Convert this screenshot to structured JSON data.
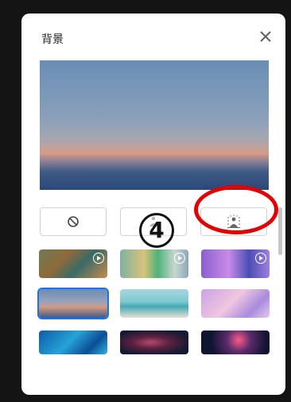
{
  "dialog": {
    "title": "背景",
    "close_icon": "close-icon"
  },
  "options": [
    {
      "icon": "no-background-icon"
    },
    {
      "icon": "blur-slight-icon"
    },
    {
      "icon": "blur-strong-icon"
    }
  ],
  "thumbnails": [
    {
      "name": "fantasy-forest",
      "animated": true
    },
    {
      "name": "classroom",
      "animated": true
    },
    {
      "name": "purple-building",
      "animated": true
    },
    {
      "name": "sunset-horizon",
      "animated": false,
      "selected": true
    },
    {
      "name": "beach",
      "animated": false
    },
    {
      "name": "pink-clouds",
      "animated": false
    },
    {
      "name": "blue-water",
      "animated": false
    },
    {
      "name": "galaxy",
      "animated": false
    },
    {
      "name": "fireworks",
      "animated": false
    }
  ],
  "annotation": {
    "number_label": "4",
    "circled_number": "④",
    "highlight_color": "#e60000"
  }
}
